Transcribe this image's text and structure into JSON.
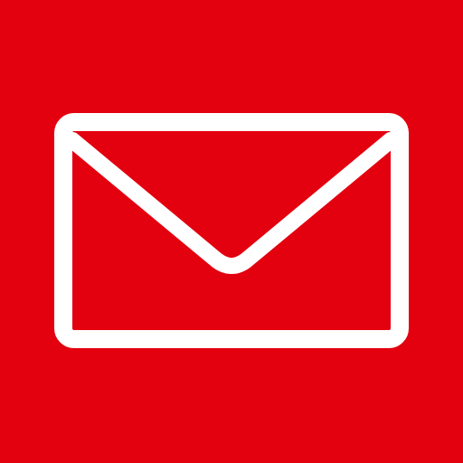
{
  "icon": {
    "name": "mail-icon",
    "background_color": "#E3000F",
    "stroke_color": "#FFFFFF"
  }
}
